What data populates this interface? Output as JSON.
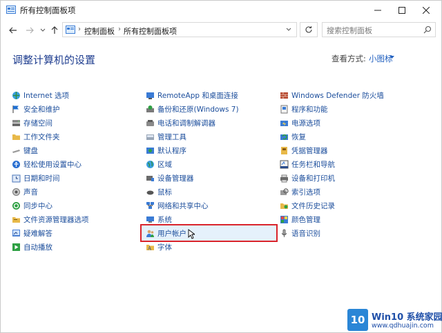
{
  "window": {
    "title": "所有控制面板项"
  },
  "address": {
    "crumbs": [
      "控制面板",
      "所有控制面板项"
    ]
  },
  "search": {
    "placeholder": "搜索控制面板"
  },
  "heading": "调整计算机的设置",
  "view_by": {
    "label": "查看方式:",
    "value": "小图标"
  },
  "columns": [
    [
      {
        "label": "Internet 选项",
        "icon": "internet-options-icon"
      },
      {
        "label": "安全和维护",
        "icon": "flag-icon"
      },
      {
        "label": "存储空间",
        "icon": "storage-icon"
      },
      {
        "label": "工作文件夹",
        "icon": "folder-icon"
      },
      {
        "label": "键盘",
        "icon": "keyboard-icon"
      },
      {
        "label": "轻松使用设置中心",
        "icon": "ease-of-access-icon"
      },
      {
        "label": "日期和时间",
        "icon": "clock-icon"
      },
      {
        "label": "声音",
        "icon": "speaker-icon"
      },
      {
        "label": "同步中心",
        "icon": "sync-icon"
      },
      {
        "label": "文件资源管理器选项",
        "icon": "folder-options-icon"
      },
      {
        "label": "疑难解答",
        "icon": "troubleshoot-icon"
      },
      {
        "label": "自动播放",
        "icon": "autoplay-icon"
      }
    ],
    [
      {
        "label": "RemoteApp 和桌面连接",
        "icon": "remoteapp-icon"
      },
      {
        "label": "备份和还原(Windows 7)",
        "icon": "backup-icon"
      },
      {
        "label": "电话和调制解调器",
        "icon": "phone-icon"
      },
      {
        "label": "管理工具",
        "icon": "admin-tools-icon"
      },
      {
        "label": "默认程序",
        "icon": "default-programs-icon"
      },
      {
        "label": "区域",
        "icon": "globe-icon"
      },
      {
        "label": "设备管理器",
        "icon": "device-manager-icon"
      },
      {
        "label": "鼠标",
        "icon": "mouse-icon"
      },
      {
        "label": "网络和共享中心",
        "icon": "network-icon"
      },
      {
        "label": "系统",
        "icon": "system-icon"
      },
      {
        "label": "用户帐户",
        "icon": "user-accounts-icon"
      },
      {
        "label": "字体",
        "icon": "font-icon"
      }
    ],
    [
      {
        "label": "Windows Defender 防火墙",
        "icon": "firewall-icon"
      },
      {
        "label": "程序和功能",
        "icon": "programs-icon"
      },
      {
        "label": "电源选项",
        "icon": "power-icon"
      },
      {
        "label": "恢复",
        "icon": "recovery-icon"
      },
      {
        "label": "凭据管理器",
        "icon": "credential-icon"
      },
      {
        "label": "任务栏和导航",
        "icon": "taskbar-icon"
      },
      {
        "label": "设备和打印机",
        "icon": "printer-icon"
      },
      {
        "label": "索引选项",
        "icon": "indexing-icon"
      },
      {
        "label": "文件历史记录",
        "icon": "file-history-icon"
      },
      {
        "label": "颜色管理",
        "icon": "color-management-icon"
      },
      {
        "label": "语音识别",
        "icon": "microphone-icon"
      }
    ]
  ],
  "watermark": {
    "badge": "10",
    "title": "Win10 系统家园",
    "url": "www.qdhuajin.com"
  },
  "colors": {
    "link": "#1c4e9c",
    "heading": "#1e3d8f",
    "highlight_border": "#d9232b",
    "highlight_fill": "#e5f1fb"
  }
}
